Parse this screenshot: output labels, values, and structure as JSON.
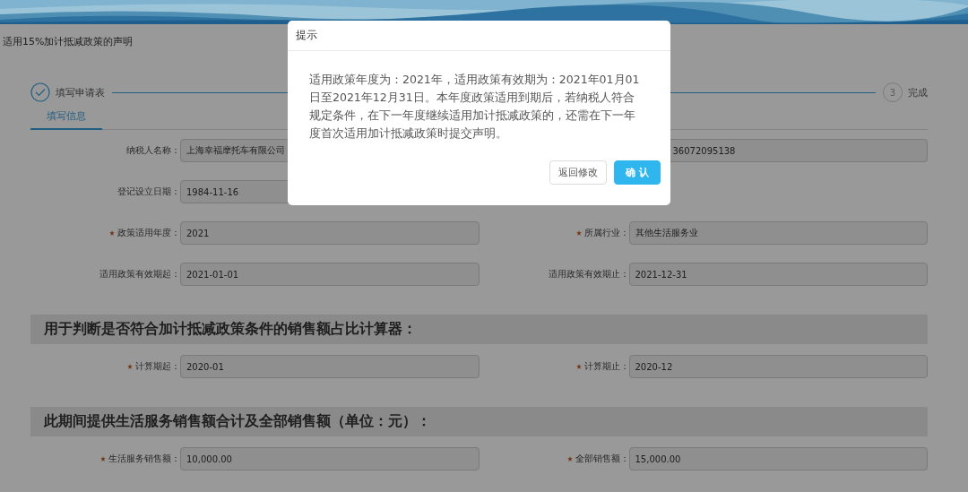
{
  "page_title": "适用15%加计抵减政策的声明",
  "steps": [
    {
      "label": "填写申请表",
      "done": true
    },
    {
      "number": "3",
      "label": "完成",
      "done": false
    }
  ],
  "tabs": [
    {
      "label": "填写信息",
      "selected": true
    }
  ],
  "sections": [
    {
      "rows": [
        {
          "left": {
            "label": "纳税人名称：",
            "required": false,
            "value": "上海幸福摩托车有限公司"
          },
          "right": {
            "value": "36072095138",
            "obscured": true
          }
        },
        {
          "left": {
            "label": "登记设立日期：",
            "required": false,
            "value": "1984-11-16"
          }
        },
        {
          "left": {
            "label": "政策适用年度：",
            "required": true,
            "value": "2021"
          },
          "right": {
            "label": "所属行业：",
            "required": true,
            "value": "其他生活服务业",
            "obscured": false
          }
        },
        {
          "left": {
            "label": "适用政策有效期起：",
            "required": false,
            "value": "2021-01-01"
          },
          "right": {
            "label": "适用政策有效期止：",
            "required": false,
            "value": "2021-12-31",
            "obscured": false
          }
        }
      ]
    },
    {
      "heading": "用于判断是否符合加计抵减政策条件的销售额占比计算器：",
      "rows": [
        {
          "left": {
            "label": "计算期起：",
            "required": true,
            "value": "2020-01"
          },
          "right": {
            "label": "计算期止：",
            "required": true,
            "value": "2020-12",
            "obscured": false
          }
        }
      ]
    },
    {
      "heading": "此期间提供生活服务销售额合计及全部销售额（单位：元）：",
      "rows": [
        {
          "left": {
            "label": "生活服务销售额：",
            "required": true,
            "value": "10,000.00"
          },
          "right": {
            "label": "全部销售额：",
            "required": true,
            "value": "15,000.00",
            "obscured": false
          }
        }
      ]
    }
  ],
  "dialog": {
    "title": "提示",
    "message": "适用政策年度为：2021年，适用政策有效期为：2021年01月01日至2021年12月31日。本年度政策适用到期后，若纳税人符合规定条件，在下一年度继续适用加计抵减政策的，还需在下一年度首次适用加计抵减政策时提交声明。",
    "buttons": [
      {
        "label": "返回修改",
        "kind": "secondary"
      },
      {
        "label": "确 认",
        "kind": "primary"
      }
    ]
  }
}
